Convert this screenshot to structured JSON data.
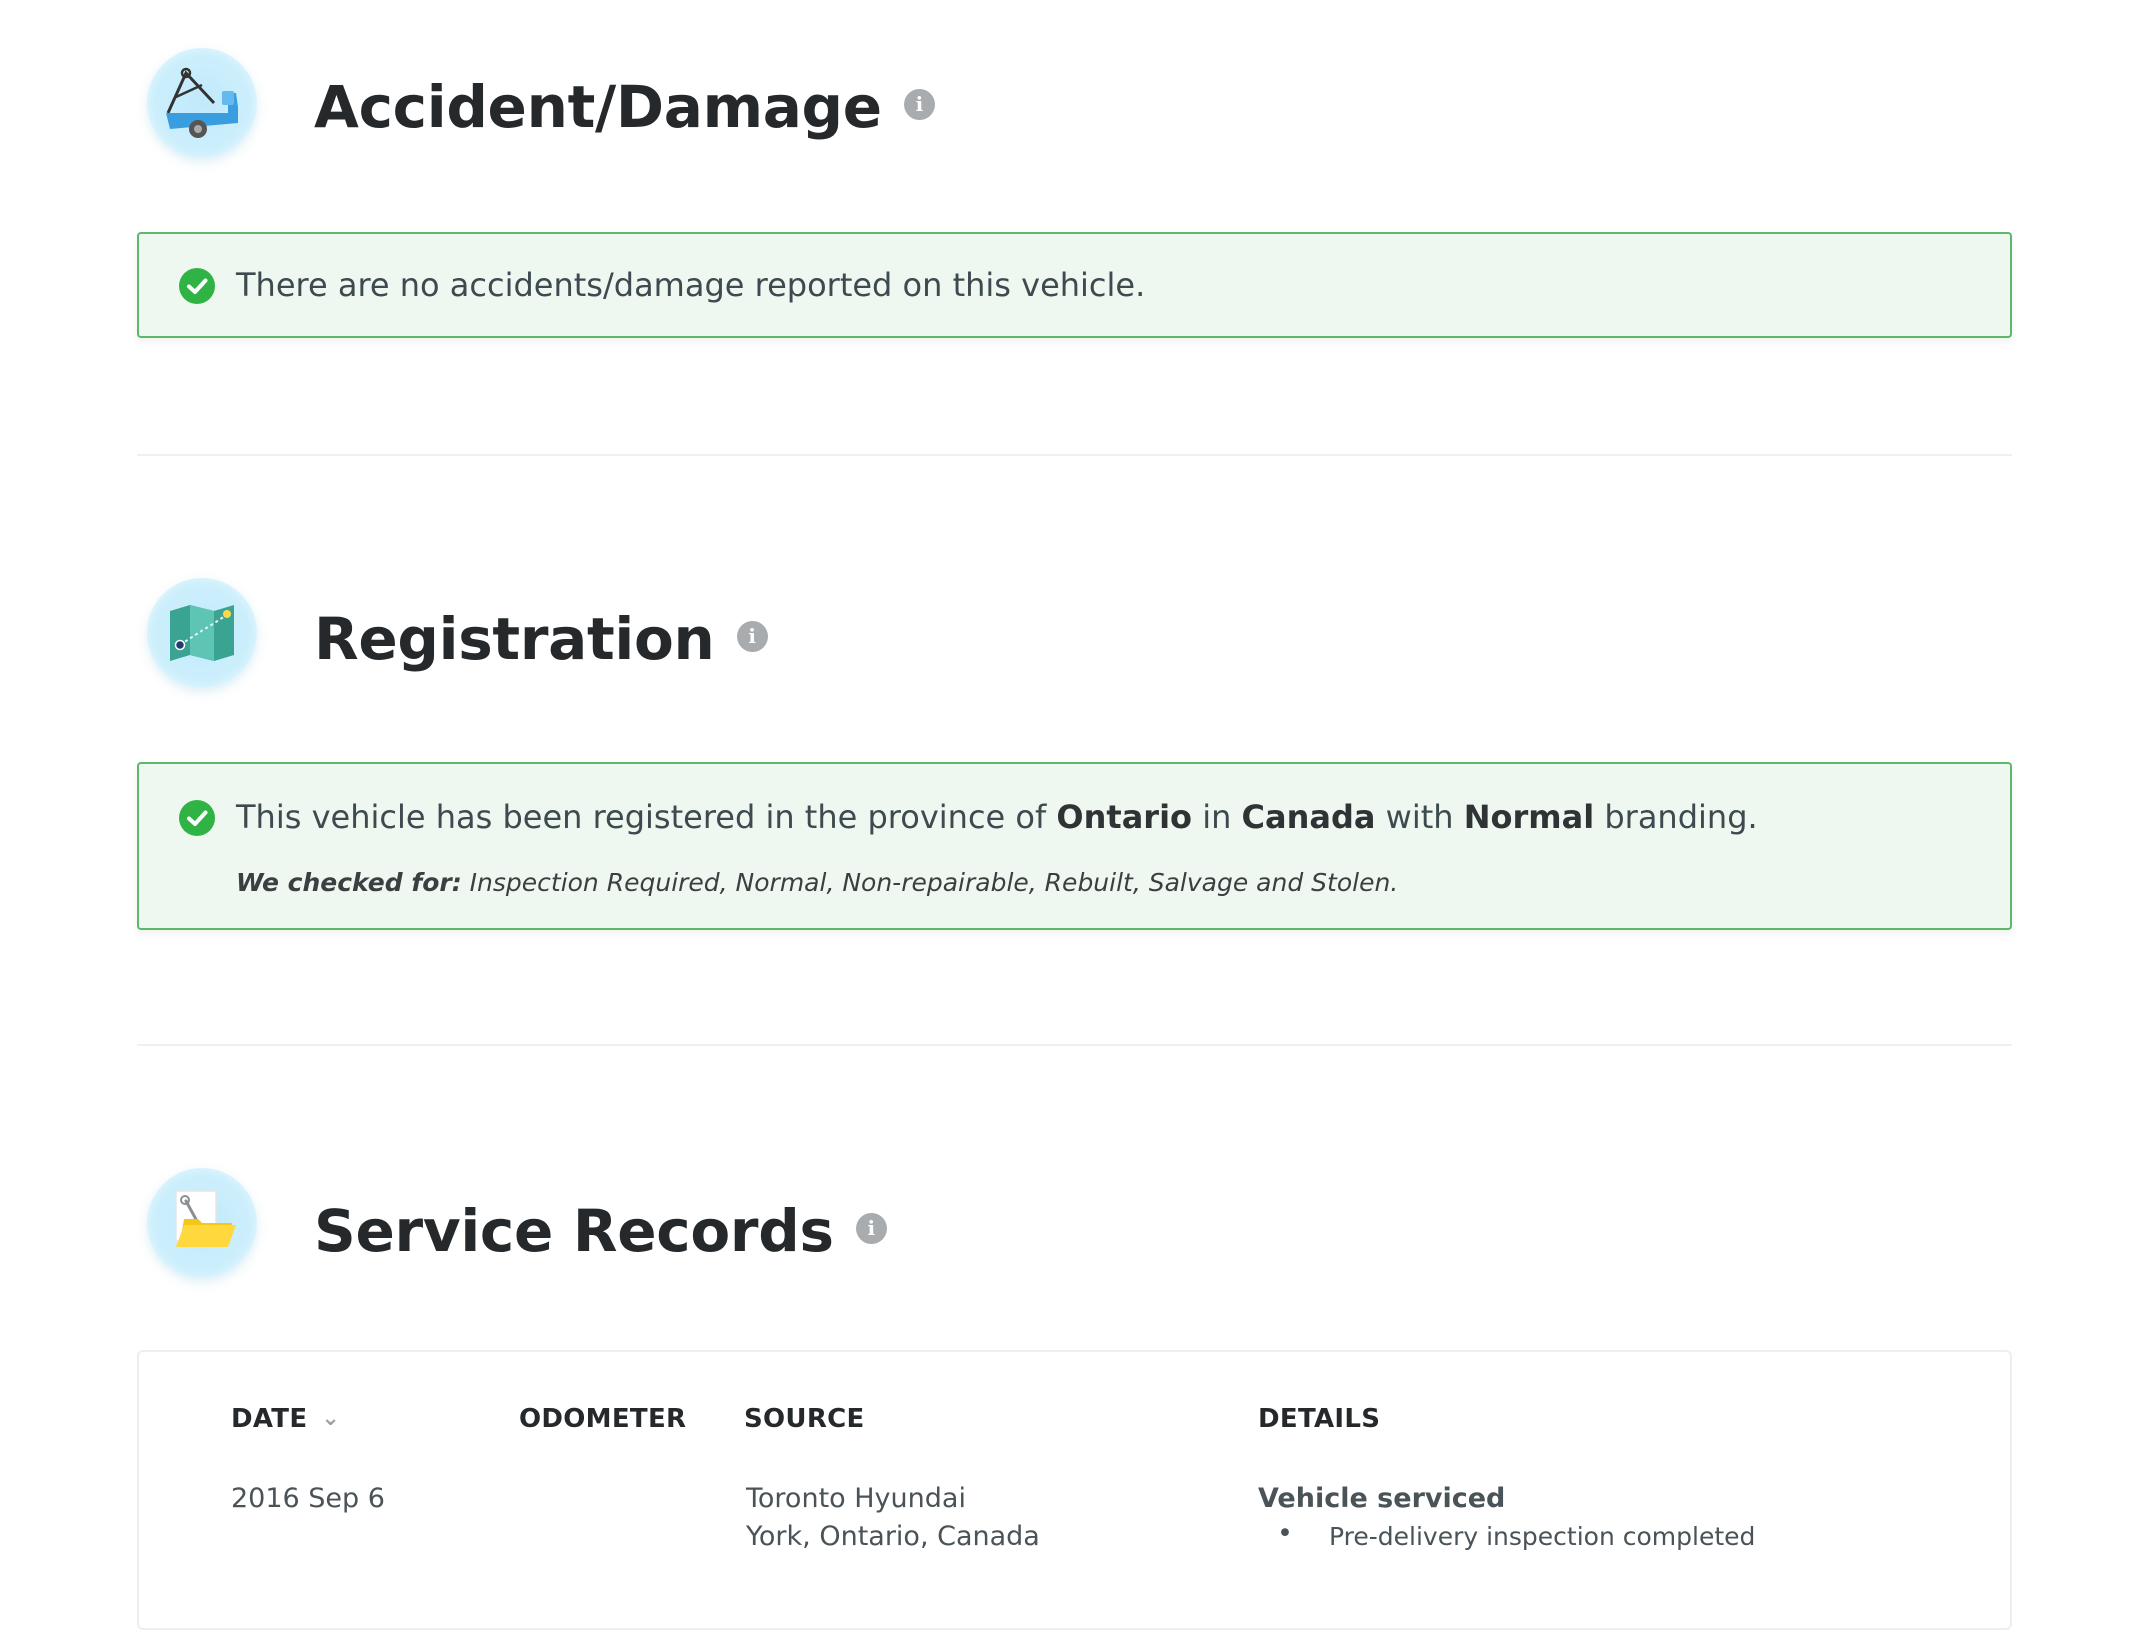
{
  "sections": {
    "accident": {
      "title": "Accident/Damage",
      "info_icon": "i",
      "message": "There are no accidents/damage reported on this vehicle."
    },
    "registration": {
      "title": "Registration",
      "info_icon": "i",
      "message_prefix": "This vehicle has been registered in the province of ",
      "province": "Ontario",
      "connector_in": " in ",
      "country": "Canada",
      "connector_with": " with ",
      "branding": "Normal",
      "message_suffix": " branding.",
      "checked_label": "We checked for:",
      "checked_items": " Inspection Required, Normal, Non-repairable, Rebuilt, Salvage and Stolen."
    },
    "service": {
      "title": "Service Records",
      "info_icon": "i",
      "columns": {
        "date": "DATE",
        "odometer": "ODOMETER",
        "source": "SOURCE",
        "details": "DETAILS"
      },
      "rows": [
        {
          "date": "2016 Sep 6",
          "odometer": "",
          "source_line1": "Toronto Hyundai",
          "source_line2": "York, Ontario, Canada",
          "details_title": "Vehicle serviced",
          "details_item": "Pre-delivery inspection completed"
        }
      ]
    }
  },
  "icons": {
    "accident": "tow-truck-icon",
    "registration": "map-icon",
    "service": "folder-wrench-icon",
    "check": "check-circle-icon",
    "info": "info-icon",
    "sort": "chevron-down-icon"
  },
  "colors": {
    "success_border": "#5cb86a",
    "success_bg": "#eef8f0",
    "check_green": "#2fb344"
  }
}
